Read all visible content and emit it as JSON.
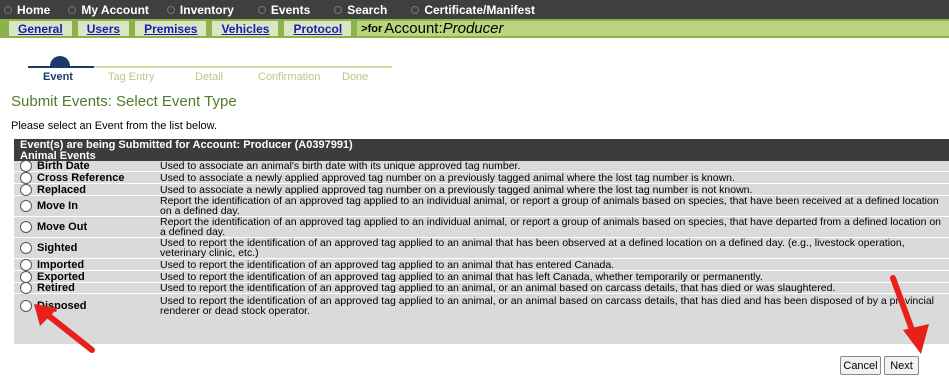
{
  "topnav": {
    "items": [
      {
        "label": "Home"
      },
      {
        "label": "My Account"
      },
      {
        "label": "Inventory"
      },
      {
        "label": "Events"
      },
      {
        "label": "Search"
      },
      {
        "label": "Certificate/Manifest"
      }
    ]
  },
  "subnav": {
    "tabs": [
      {
        "label": "General"
      },
      {
        "label": "Users"
      },
      {
        "label": "Premises"
      },
      {
        "label": "Vehicles"
      },
      {
        "label": "Protocol"
      }
    ],
    "context_prefix": ">for",
    "context_account": "Account:",
    "context_type": "Producer"
  },
  "steps": {
    "items": [
      "Event",
      "Tag Entry",
      "Detail",
      "Confirmation",
      "Done"
    ],
    "active_index": 0
  },
  "page": {
    "title": "Submit Events: Select Event Type",
    "instruction": "Please select an Event from the list below."
  },
  "panel": {
    "header_line1": "Event(s) are being Submitted for Account: Producer (A0397991)",
    "header_line2": "Animal Events",
    "events": [
      {
        "name": "Birth Date",
        "desc": "Used to associate an animal's birth date with its unique approved tag number."
      },
      {
        "name": "Cross Reference",
        "desc": "Used to associate a newly applied approved tag number on a previously tagged animal where the lost tag number is known."
      },
      {
        "name": "Replaced",
        "desc": "Used to associate a newly applied approved tag number on a previously tagged animal where the lost tag number is not known."
      },
      {
        "name": "Move In",
        "desc": "Report the identification of an approved tag applied to an individual animal, or report a group of animals based on species, that have been received at a defined location on a defined day."
      },
      {
        "name": "Move Out",
        "desc": "Report the identification of an approved tag applied to an individual animal, or report a group of animals based on species, that have departed from a defined location on a defined day."
      },
      {
        "name": "Sighted",
        "desc": "Used to report the identification of an approved tag applied to an animal that has been observed at a defined location on a defined day. (e.g., livestock operation, veterinary clinic, etc.)"
      },
      {
        "name": "Imported",
        "desc": "Used to report the identification of an approved tag applied to an animal that has entered Canada."
      },
      {
        "name": "Exported",
        "desc": "Used to report the identification of an approved tag applied to an animal that has left Canada, whether temporarily or permanently."
      },
      {
        "name": "Retired",
        "desc": "Used to report the identification of an approved tag applied to an animal, or an animal based on carcass details, that has died or was slaughtered."
      },
      {
        "name": "Disposed",
        "desc": "Used to report the identification of an approved tag applied to an animal, or an animal based on carcass details, that has died and has been disposed of by a provincial renderer or dead stock operator."
      }
    ]
  },
  "buttons": {
    "cancel": "Cancel",
    "next": "Next"
  },
  "colors": {
    "topnav_bg": "#3f3f3f",
    "subnav_bg": "#8cb34a",
    "title_green": "#4f7b2a",
    "panel_header_bg": "#3c3c3c",
    "panel_bg": "#dadada",
    "annotation_arrow": "#e8201a"
  }
}
